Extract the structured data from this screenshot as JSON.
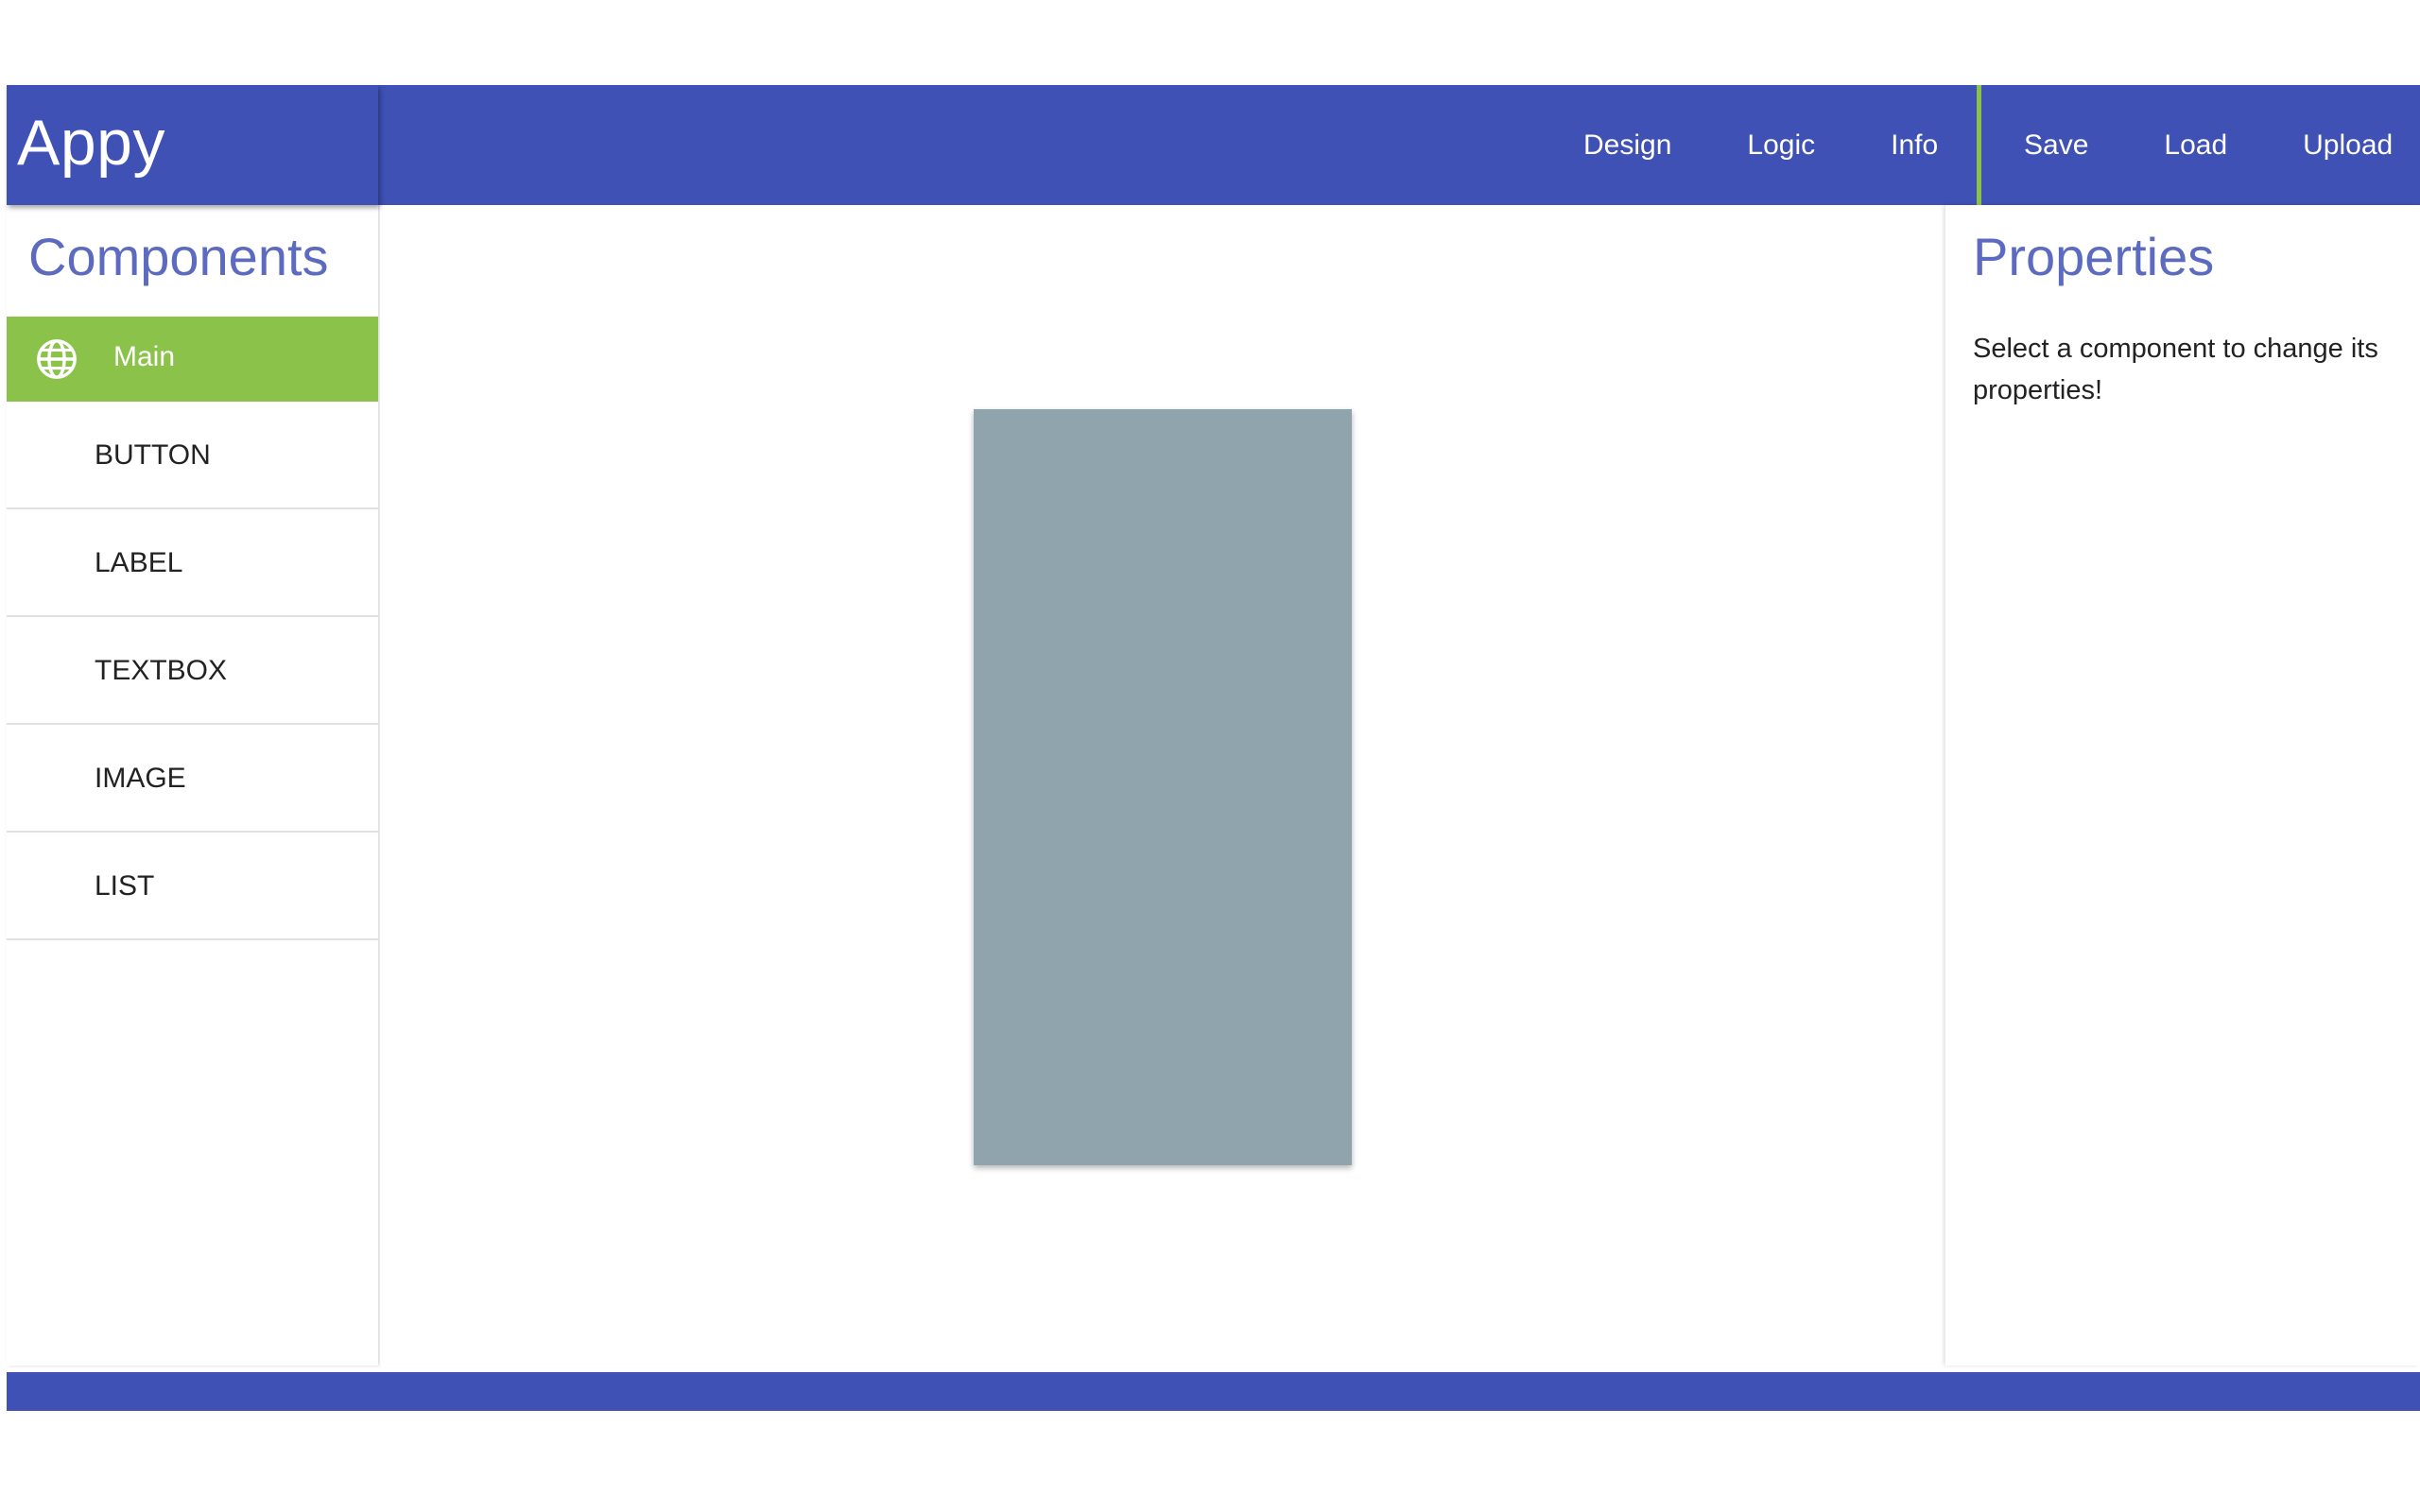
{
  "app": {
    "title": "Appy"
  },
  "colors": {
    "primary": "#3f51b5",
    "accent": "#8bc34a",
    "heading": "#5c6bc0",
    "phone": "#90a4ae"
  },
  "nav": {
    "left": [
      {
        "label": "Design"
      },
      {
        "label": "Logic"
      },
      {
        "label": "Info"
      }
    ],
    "right": [
      {
        "label": "Save"
      },
      {
        "label": "Load"
      },
      {
        "label": "Upload"
      }
    ]
  },
  "sidebar": {
    "title": "Components",
    "selected": {
      "label": "Main",
      "icon": "globe-icon"
    },
    "items": [
      {
        "label": "BUTTON"
      },
      {
        "label": "LABEL"
      },
      {
        "label": "TEXTBOX"
      },
      {
        "label": "IMAGE"
      },
      {
        "label": "LIST"
      }
    ]
  },
  "properties": {
    "title": "Properties",
    "message": "Select a component to change its properties!"
  }
}
